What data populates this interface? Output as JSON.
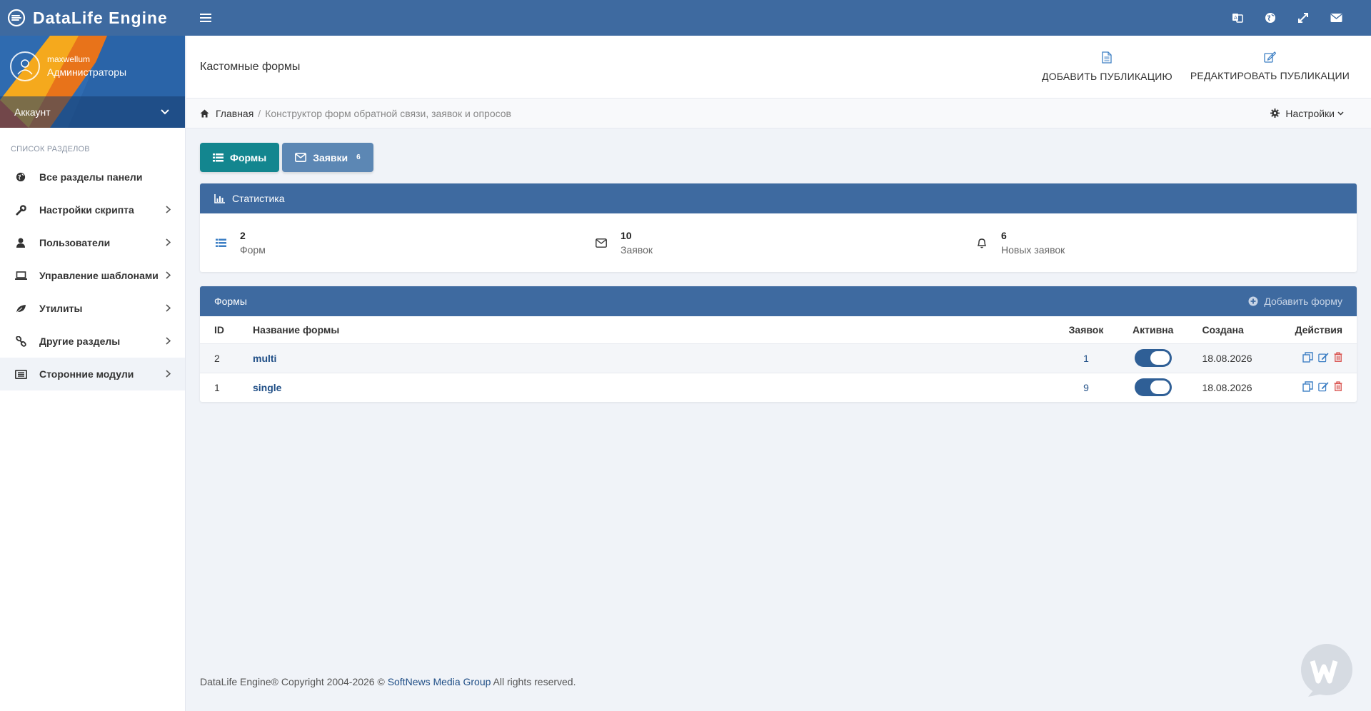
{
  "app": {
    "title": "DataLife Engine"
  },
  "colors": {
    "topbar": "#3e6aa0",
    "teal": "#13868f",
    "blue_button": "#5c87b4",
    "link": "#1f4e86",
    "delete": "#d9534f"
  },
  "topbar_icons": [
    "translate-icon",
    "globe-icon",
    "expand-icon",
    "mail-icon"
  ],
  "profile": {
    "username": "maxwellum",
    "role": "Администраторы",
    "account_label": "Аккаунт"
  },
  "sidebar": {
    "section_title": "Список разделов",
    "items": [
      {
        "label": "Все разделы панели",
        "icon": "globe-icon",
        "has_arrow": false
      },
      {
        "label": "Настройки скрипта",
        "icon": "wrench-icon",
        "has_arrow": true
      },
      {
        "label": "Пользователи",
        "icon": "user-icon",
        "has_arrow": true
      },
      {
        "label": "Управление шаблонами",
        "icon": "laptop-icon",
        "has_arrow": true
      },
      {
        "label": "Утилиты",
        "icon": "leaf-icon",
        "has_arrow": true
      },
      {
        "label": "Другие разделы",
        "icon": "link-icon",
        "has_arrow": true
      },
      {
        "label": "Сторонние модули",
        "icon": "list-card-icon",
        "has_arrow": true,
        "active": true
      }
    ]
  },
  "header": {
    "title": "Кастомные формы",
    "add_publication": "ДОБАВИТЬ ПУБЛИКАЦИЮ",
    "edit_publications": "РЕДАКТИРОВАТЬ ПУБЛИКАЦИИ"
  },
  "breadcrumb": {
    "home": "Главная",
    "separator": "/",
    "current": "Конструктор форм обратной связи, заявок и опросов",
    "settings": "Настройки"
  },
  "buttons": {
    "forms": "Формы",
    "requests": "Заявки",
    "requests_badge": "6"
  },
  "stats": {
    "title": "Статистика",
    "items": [
      {
        "value": "2",
        "label": "Форм"
      },
      {
        "value": "10",
        "label": "Заявок"
      },
      {
        "value": "6",
        "label": "Новых заявок"
      }
    ]
  },
  "forms_table": {
    "title": "Формы",
    "add_label": "Добавить форму",
    "columns": {
      "id": "ID",
      "name": "Название формы",
      "count": "Заявок",
      "active": "Активна",
      "created": "Создана",
      "actions": "Действия"
    },
    "rows": [
      {
        "id": "2",
        "name": "multi",
        "count": "1",
        "active": true,
        "created": "18.08.2026"
      },
      {
        "id": "1",
        "name": "single",
        "count": "9",
        "active": true,
        "created": "18.08.2026"
      }
    ]
  },
  "footer": {
    "prefix": "DataLife Engine® Copyright 2004-2026 ©",
    "company": "SoftNews Media Group",
    "suffix": "All rights reserved."
  }
}
